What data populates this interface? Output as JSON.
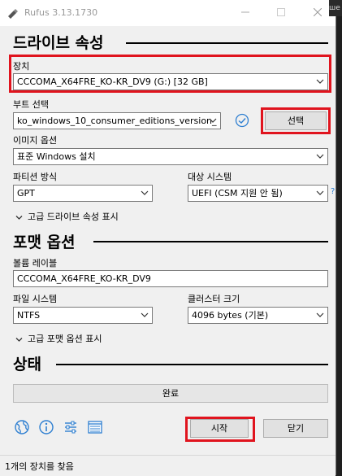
{
  "window": {
    "title": "Rufus 3.13.1730",
    "background_badge": "ше"
  },
  "drive_section": {
    "heading": "드라이브 속성",
    "device_label": "장치",
    "device_value": "CCCOMA_X64FRE_KO-KR_DV9 (G:) [32 GB]",
    "boot_label": "부트 선택",
    "boot_value": "ko_windows_10_consumer_editions_version_",
    "select_button": "선택",
    "image_option_label": "이미지 옵션",
    "image_option_value": "표준 Windows 설치",
    "partition_label": "파티션 방식",
    "partition_value": "GPT",
    "target_label": "대상 시스템",
    "target_value": "UEFI (CSM 지원 안 됨)",
    "help_mark": "?",
    "advanced_toggle": "고급 드라이브 속성 표시"
  },
  "format_section": {
    "heading": "포맷 옵션",
    "volume_label": "볼륨 레이블",
    "volume_value": "CCCOMA_X64FRE_KO-KR_DV9",
    "fs_label": "파일 시스템",
    "fs_value": "NTFS",
    "cluster_label": "클러스터 크기",
    "cluster_value": "4096 bytes (기본)",
    "advanced_toggle": "고급 포맷 옵션 표시"
  },
  "status_section": {
    "heading": "상태",
    "progress_text": "완료",
    "progress_fraction": 1.0
  },
  "buttons": {
    "start": "시작",
    "close": "닫기"
  },
  "statusbar": {
    "text": "1개의 장치를 찾음"
  },
  "colors": {
    "highlight_red": "#e0141e",
    "check_blue": "#2e7fd1"
  },
  "icons": [
    "globe-icon",
    "info-icon",
    "settings-sliders-icon",
    "log-icon",
    "check-circle-icon"
  ]
}
